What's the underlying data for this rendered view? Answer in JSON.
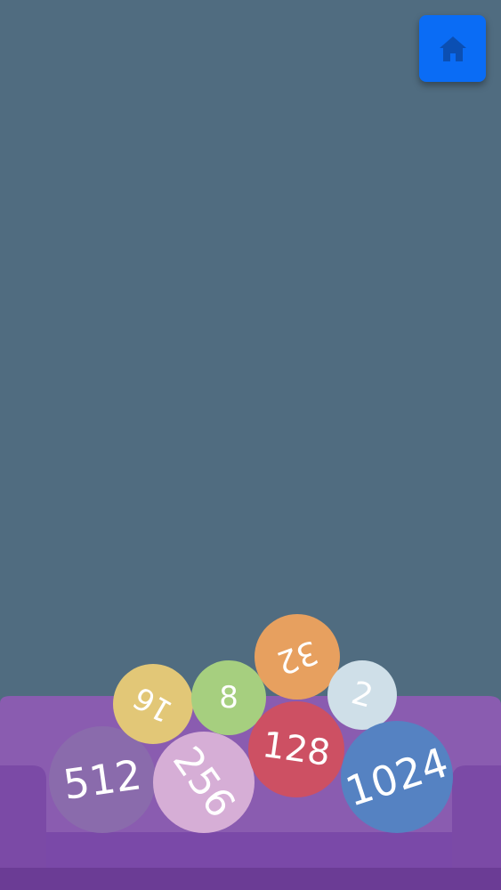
{
  "game": {
    "background_color": "#506c80",
    "home_button": {
      "icon": "home-icon",
      "color": "#0a6cf5",
      "icon_color": "#0b4fb3"
    },
    "sofa": {
      "color": "#8a5cb0",
      "shade_color": "#6f3f98",
      "dark_color": "#5a2e80"
    },
    "balls": [
      {
        "value": "512",
        "color": "#8a6bac",
        "text_color": "#ffffff"
      },
      {
        "value": "256",
        "color": "#d6aed6",
        "text_color": "#ffffff"
      },
      {
        "value": "16",
        "color": "#e2c777",
        "text_color": "#ffffff"
      },
      {
        "value": "8",
        "color": "#a6cf7f",
        "text_color": "#ffffff"
      },
      {
        "value": "32",
        "color": "#e7a05f",
        "text_color": "#ffffff"
      },
      {
        "value": "128",
        "color": "#cd5063",
        "text_color": "#ffffff"
      },
      {
        "value": "2",
        "color": "#cfdfe8",
        "text_color": "#6d7a82"
      },
      {
        "value": "1024",
        "color": "#5582c2",
        "text_color": "#ffffff"
      }
    ]
  }
}
